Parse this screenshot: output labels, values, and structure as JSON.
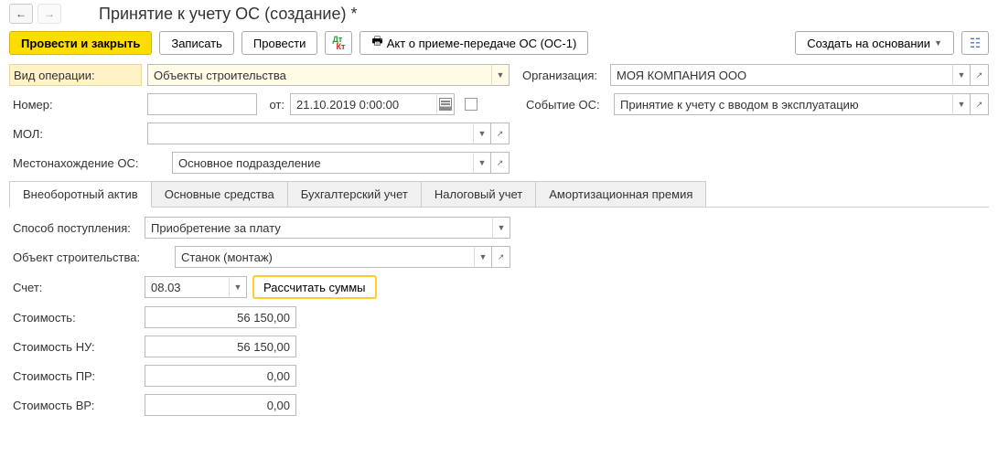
{
  "header": {
    "title": "Принятие к учету ОС (создание) *"
  },
  "toolbar": {
    "post_and_close": "Провести и закрыть",
    "save": "Записать",
    "post": "Провести",
    "act_label": "Акт о приеме-передаче ОС (ОС-1)",
    "create_based_on": "Создать на основании"
  },
  "form": {
    "operation_type_label": "Вид операции:",
    "operation_type_value": "Объекты строительства",
    "organization_label": "Организация:",
    "organization_value": "МОЯ КОМПАНИЯ ООО",
    "number_label": "Номер:",
    "number_value": "",
    "date_prefix": "от:",
    "date_value": "21.10.2019  0:00:00",
    "event_label": "Событие ОС:",
    "event_value": "Принятие к учету с вводом в эксплуатацию",
    "mol_label": "МОЛ:",
    "mol_value": "",
    "location_label": "Местонахождение ОС:",
    "location_value": "Основное подразделение"
  },
  "tabs": {
    "t1": "Внеоборотный актив",
    "t2": "Основные средства",
    "t3": "Бухгалтерский учет",
    "t4": "Налоговый учет",
    "t5": "Амортизационная премия"
  },
  "pane": {
    "receipt_method_label": "Способ поступления:",
    "receipt_method_value": "Приобретение за плату",
    "construction_object_label": "Объект строительства:",
    "construction_object_value": "Станок (монтаж)",
    "account_label": "Счет:",
    "account_value": "08.03",
    "calc_sums": "Рассчитать суммы",
    "cost_label": "Стоимость:",
    "cost_value": "56 150,00",
    "cost_nu_label": "Стоимость НУ:",
    "cost_nu_value": "56 150,00",
    "cost_pr_label": "Стоимость ПР:",
    "cost_pr_value": "0,00",
    "cost_vr_label": "Стоимость ВР:",
    "cost_vr_value": "0,00"
  }
}
